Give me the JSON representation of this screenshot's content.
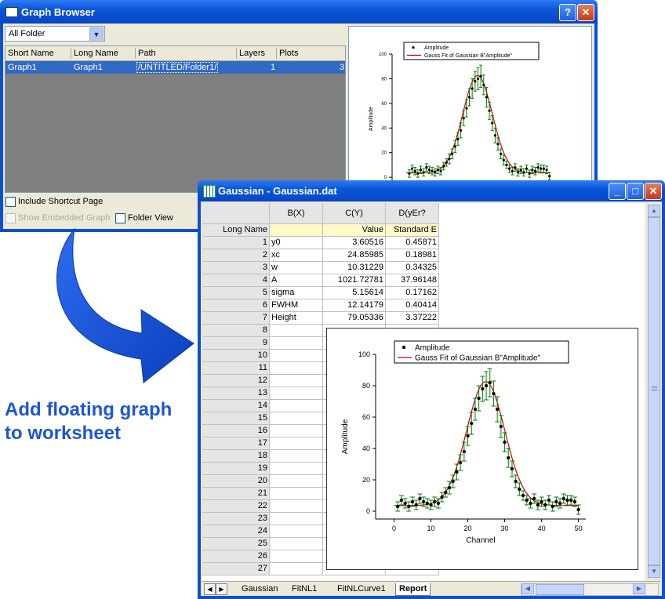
{
  "graph_browser": {
    "title": "Graph Browser",
    "help_button": "?",
    "close_button": "✕",
    "folder_select": "All Folder",
    "columns": [
      "Short Name",
      "Long Name",
      "Path",
      "Layers",
      "Plots"
    ],
    "rows": [
      {
        "short_name": "Graph1",
        "long_name": "Graph1",
        "path": "/UNTITLED/Folder1/",
        "layers": "1",
        "plots": "3"
      }
    ],
    "include_shortcut_label": "Include Shortcut Page",
    "show_embedded_label": "Show Embedded Graph",
    "folder_view_label": "Folder View"
  },
  "gaussian_window": {
    "title": "Gaussian - Gaussian.dat",
    "min_button": "_",
    "max_button": "□",
    "close_button": "✕",
    "columns": [
      "B(X)",
      "C(Y)",
      "D(yEr?"
    ],
    "long_name_label": "Long Name",
    "long_name_values": [
      "",
      "Value",
      "Standard E"
    ],
    "rows": [
      {
        "n": "1",
        "b": "y0",
        "c": "3.60516",
        "d": "0.45871"
      },
      {
        "n": "2",
        "b": "xc",
        "c": "24.85985",
        "d": "0.18981"
      },
      {
        "n": "3",
        "b": "w",
        "c": "10.31229",
        "d": "0.34325"
      },
      {
        "n": "4",
        "b": "A",
        "c": "1021.72781",
        "d": "37.96148"
      },
      {
        "n": "5",
        "b": "sigma",
        "c": "5.15614",
        "d": "0.17162"
      },
      {
        "n": "6",
        "b": "FWHM",
        "c": "12.14179",
        "d": "0.40414"
      },
      {
        "n": "7",
        "b": "Height",
        "c": "79.05336",
        "d": "3.37222"
      }
    ],
    "empty_rows": [
      "8",
      "9",
      "10",
      "11",
      "12",
      "13",
      "14",
      "15",
      "16",
      "17",
      "18",
      "19",
      "20",
      "21",
      "22",
      "23",
      "24",
      "25",
      "26",
      "27"
    ],
    "tabs": [
      "Gaussian",
      "FitNL1",
      "FitNLCurve1",
      "Report"
    ],
    "active_tab": "Report"
  },
  "annotation": {
    "line1": "Add floating graph",
    "line2": "to worksheet"
  },
  "colors": {
    "title_blue": "#0b56d8",
    "fit_line": "#cc0000",
    "error_bars": "#008000",
    "annotation_blue": "#1c56d6"
  },
  "chart_data": {
    "type": "scatter",
    "xlabel": "Channel",
    "ylabel": "Amplitude",
    "xlim": [
      -5,
      52
    ],
    "ylim": [
      -5,
      100
    ],
    "xticks": [
      0,
      10,
      20,
      30,
      40,
      50
    ],
    "yticks": [
      0,
      20,
      40,
      60,
      80,
      100
    ],
    "series": [
      {
        "name": "Amplitude",
        "x": [
          1,
          2,
          3,
          4,
          5,
          6,
          7,
          8,
          9,
          10,
          11,
          12,
          13,
          14,
          15,
          16,
          17,
          18,
          19,
          20,
          21,
          22,
          23,
          24,
          25,
          26,
          27,
          28,
          29,
          30,
          31,
          32,
          33,
          34,
          35,
          36,
          37,
          38,
          39,
          40,
          41,
          42,
          43,
          44,
          45,
          46,
          47,
          48,
          49,
          50
        ],
        "y": [
          3,
          7,
          5,
          3,
          6,
          4,
          8,
          6,
          5,
          4,
          6,
          5,
          9,
          12,
          15,
          19,
          25,
          31,
          38,
          48,
          56,
          65,
          72,
          78,
          80,
          82,
          75,
          65,
          54,
          44,
          34,
          27,
          19,
          14,
          10,
          7,
          5,
          8,
          4,
          6,
          4,
          7,
          3,
          6,
          5,
          8,
          7,
          7,
          6,
          1
        ],
        "err": [
          3,
          3,
          3,
          3,
          3,
          3,
          3,
          3,
          3,
          3,
          3,
          3,
          3,
          3,
          4,
          4,
          5,
          5,
          6,
          6,
          7,
          7,
          8,
          8,
          9,
          9,
          8,
          8,
          7,
          6,
          6,
          5,
          4,
          4,
          3,
          3,
          3,
          3,
          3,
          3,
          3,
          3,
          3,
          3,
          3,
          3,
          3,
          3,
          3,
          3
        ]
      },
      {
        "name": "Gauss Fit of Gaussian B\"Amplitude\"",
        "fit": {
          "y0": 3.60516,
          "xc": 24.85985,
          "w": 10.31229,
          "A": 1021.72781
        }
      }
    ]
  }
}
